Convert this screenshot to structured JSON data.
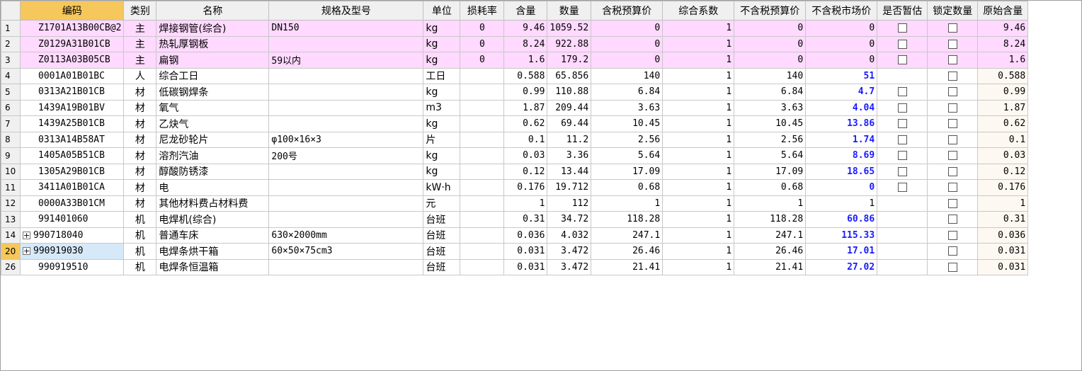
{
  "columns": [
    "",
    "编码",
    "类别",
    "名称",
    "规格及型号",
    "单位",
    "损耗率",
    "含量",
    "数量",
    "含税预算价",
    "综合系数",
    "不含税预算价",
    "不含税市场价",
    "是否暂估",
    "锁定数量",
    "原始含量"
  ],
  "rows": [
    {
      "rn": "1",
      "code": "Z1701A13B00CB@2",
      "cat": "主",
      "name": "焊接钢管(综合)",
      "spec": "DN150",
      "unit": "kg",
      "loss": "0",
      "qty": "9.46",
      "amount": "1059.52",
      "taxbud": "0",
      "coef": "1",
      "notaxbud": "0",
      "market": "0",
      "est": true,
      "lock": true,
      "orig": "9.46",
      "pink": true
    },
    {
      "rn": "2",
      "code": "Z0129A31B01CB",
      "cat": "主",
      "name": "热轧厚钢板",
      "spec": "",
      "unit": "kg",
      "loss": "0",
      "qty": "8.24",
      "amount": "922.88",
      "taxbud": "0",
      "coef": "1",
      "notaxbud": "0",
      "market": "0",
      "est": true,
      "lock": true,
      "orig": "8.24",
      "pink": true
    },
    {
      "rn": "3",
      "code": "Z0113A03B05CB",
      "cat": "主",
      "name": "扁钢",
      "spec": "59以内",
      "unit": "kg",
      "loss": "0",
      "qty": "1.6",
      "amount": "179.2",
      "taxbud": "0",
      "coef": "1",
      "notaxbud": "0",
      "market": "0",
      "est": true,
      "lock": true,
      "orig": "1.6",
      "pink": true
    },
    {
      "rn": "4",
      "code": "0001A01B01BC",
      "cat": "人",
      "name": "综合工日",
      "spec": "",
      "unit": "工日",
      "loss": "",
      "qty": "0.588",
      "amount": "65.856",
      "taxbud": "140",
      "coef": "1",
      "notaxbud": "140",
      "market": "51",
      "est": false,
      "lock": true,
      "orig": "0.588"
    },
    {
      "rn": "5",
      "code": "0313A21B01CB",
      "cat": "材",
      "name": "低碳钢焊条",
      "spec": "",
      "unit": "kg",
      "loss": "",
      "qty": "0.99",
      "amount": "110.88",
      "taxbud": "6.84",
      "coef": "1",
      "notaxbud": "6.84",
      "market": "4.7",
      "est": true,
      "lock": true,
      "orig": "0.99"
    },
    {
      "rn": "6",
      "code": "1439A19B01BV",
      "cat": "材",
      "name": "氧气",
      "spec": "",
      "unit": "m3",
      "loss": "",
      "qty": "1.87",
      "amount": "209.44",
      "taxbud": "3.63",
      "coef": "1",
      "notaxbud": "3.63",
      "market": "4.04",
      "est": true,
      "lock": true,
      "orig": "1.87"
    },
    {
      "rn": "7",
      "code": "1439A25B01CB",
      "cat": "材",
      "name": "乙炔气",
      "spec": "",
      "unit": "kg",
      "loss": "",
      "qty": "0.62",
      "amount": "69.44",
      "taxbud": "10.45",
      "coef": "1",
      "notaxbud": "10.45",
      "market": "13.86",
      "est": true,
      "lock": true,
      "orig": "0.62"
    },
    {
      "rn": "8",
      "code": "0313A14B58AT",
      "cat": "材",
      "name": "尼龙砂轮片",
      "spec": "φ100×16×3",
      "unit": "片",
      "loss": "",
      "qty": "0.1",
      "amount": "11.2",
      "taxbud": "2.56",
      "coef": "1",
      "notaxbud": "2.56",
      "market": "1.74",
      "est": true,
      "lock": true,
      "orig": "0.1"
    },
    {
      "rn": "9",
      "code": "1405A05B51CB",
      "cat": "材",
      "name": "溶剂汽油",
      "spec": "200号",
      "unit": "kg",
      "loss": "",
      "qty": "0.03",
      "amount": "3.36",
      "taxbud": "5.64",
      "coef": "1",
      "notaxbud": "5.64",
      "market": "8.69",
      "est": true,
      "lock": true,
      "orig": "0.03"
    },
    {
      "rn": "10",
      "code": "1305A29B01CB",
      "cat": "材",
      "name": "醇酸防锈漆",
      "spec": "",
      "unit": "kg",
      "loss": "",
      "qty": "0.12",
      "amount": "13.44",
      "taxbud": "17.09",
      "coef": "1",
      "notaxbud": "17.09",
      "market": "18.65",
      "est": true,
      "lock": true,
      "orig": "0.12"
    },
    {
      "rn": "11",
      "code": "3411A01B01CA",
      "cat": "材",
      "name": "电",
      "spec": "",
      "unit": "kW·h",
      "loss": "",
      "qty": "0.176",
      "amount": "19.712",
      "taxbud": "0.68",
      "coef": "1",
      "notaxbud": "0.68",
      "market": "0",
      "est": true,
      "lock": true,
      "orig": "0.176"
    },
    {
      "rn": "12",
      "code": "0000A33B01CM",
      "cat": "材",
      "name": "其他材料费占材料费",
      "spec": "",
      "unit": "元",
      "loss": "",
      "qty": "1",
      "amount": "112",
      "taxbud": "1",
      "coef": "1",
      "notaxbud": "1",
      "market": "1",
      "market_plain": true,
      "est": false,
      "lock": true,
      "orig": "1"
    },
    {
      "rn": "13",
      "code": "991401060",
      "cat": "机",
      "name": "电焊机(综合)",
      "spec": "",
      "unit": "台班",
      "loss": "",
      "qty": "0.31",
      "amount": "34.72",
      "taxbud": "118.28",
      "coef": "1",
      "notaxbud": "118.28",
      "market": "60.86",
      "est": false,
      "lock": true,
      "orig": "0.31"
    },
    {
      "rn": "14",
      "code": "990718040",
      "cat": "机",
      "name": "普通车床",
      "spec": "630×2000mm",
      "unit": "台班",
      "loss": "",
      "qty": "0.036",
      "amount": "4.032",
      "taxbud": "247.1",
      "coef": "1",
      "notaxbud": "247.1",
      "market": "115.33",
      "est": false,
      "lock": true,
      "orig": "0.036",
      "expand": "+"
    },
    {
      "rn": "20",
      "code": "990919030",
      "cat": "机",
      "name": "电焊条烘干箱",
      "spec": "60×50×75cm3",
      "unit": "台班",
      "loss": "",
      "qty": "0.031",
      "amount": "3.472",
      "taxbud": "26.46",
      "coef": "1",
      "notaxbud": "26.46",
      "market": "17.01",
      "est": false,
      "lock": true,
      "orig": "0.031",
      "expand": "+",
      "current": true
    },
    {
      "rn": "26",
      "code": "990919510",
      "cat": "机",
      "name": "电焊条恒温箱",
      "spec": "",
      "unit": "台班",
      "loss": "",
      "qty": "0.031",
      "amount": "3.472",
      "taxbud": "21.41",
      "coef": "1",
      "notaxbud": "21.41",
      "market": "27.02",
      "est": false,
      "lock": true,
      "orig": "0.031"
    }
  ]
}
